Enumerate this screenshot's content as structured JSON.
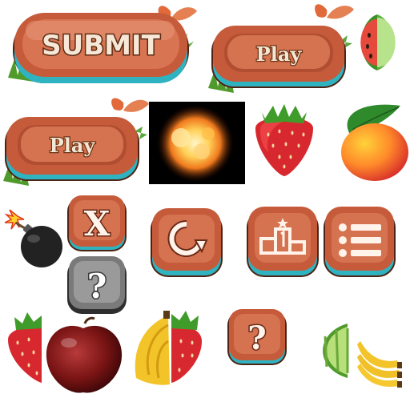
{
  "sprite_sheet": {
    "buttons": {
      "submit_label": "SUBMIT",
      "play_label_1": "Play",
      "play_label_2": "Play",
      "close_glyph": "X",
      "help_glyph_gray": "?",
      "help_glyph_wood": "?"
    },
    "icons": [
      "restart-icon",
      "leaderboard-icon",
      "menu-list-icon",
      "bomb-icon",
      "explosion-icon"
    ],
    "fruits": [
      "watermelon-half",
      "strawberry",
      "mango",
      "strawberry-half",
      "apple-half",
      "banana-half",
      "strawberry-half",
      "melon-half",
      "banana-half"
    ]
  }
}
